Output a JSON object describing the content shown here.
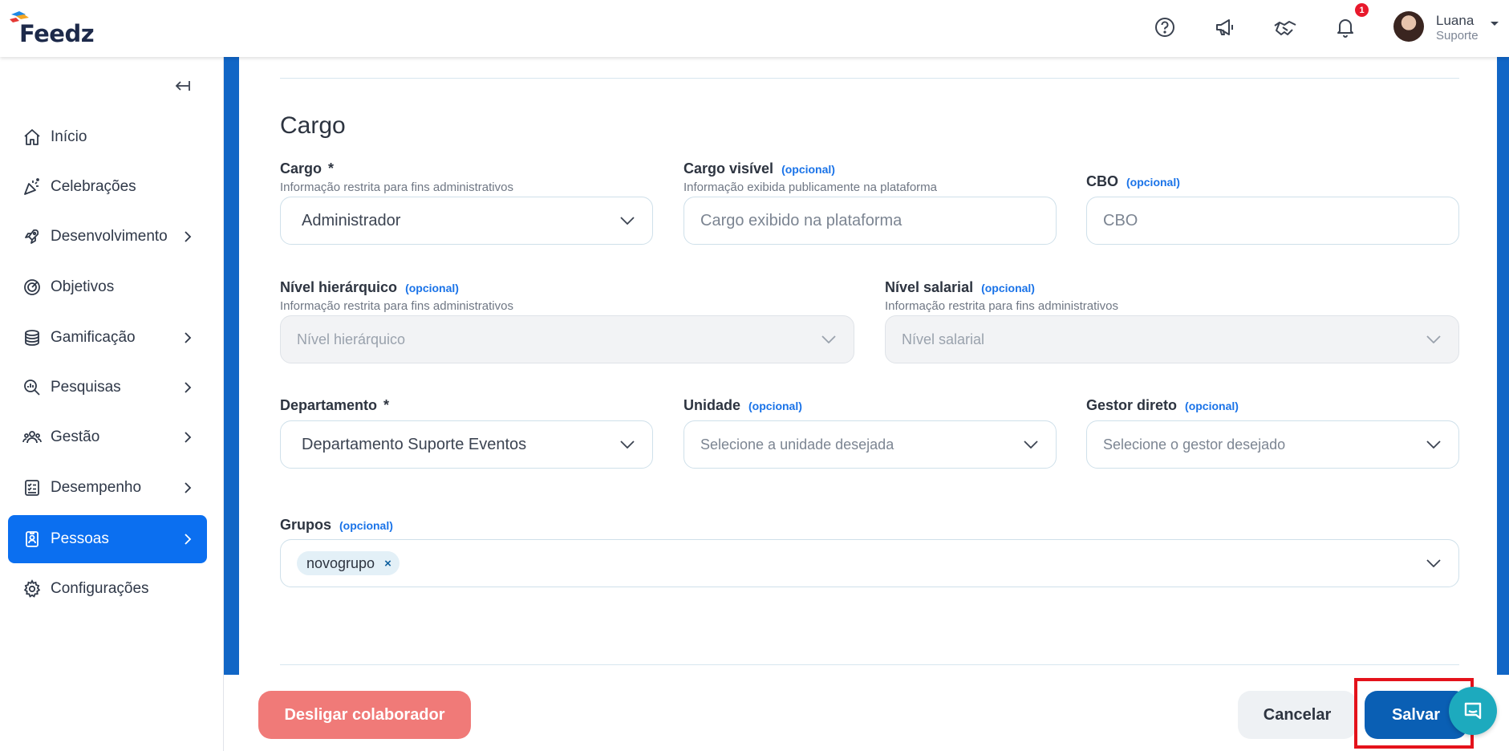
{
  "brand": {
    "name": "Feedz"
  },
  "topbar": {
    "icons": [
      "help-icon",
      "megaphone-icon",
      "handshake-icon",
      "bell-icon"
    ],
    "notification_count": "1",
    "user": {
      "name": "Luana",
      "role": "Suporte"
    }
  },
  "sidebar": {
    "items": [
      {
        "label": "Início",
        "icon": "home-icon",
        "has_children": false
      },
      {
        "label": "Celebrações",
        "icon": "party-icon",
        "has_children": false
      },
      {
        "label": "Desenvolvimento",
        "icon": "rocket-icon",
        "has_children": true
      },
      {
        "label": "Objetivos",
        "icon": "target-icon",
        "has_children": false
      },
      {
        "label": "Gamificação",
        "icon": "coins-icon",
        "has_children": true
      },
      {
        "label": "Pesquisas",
        "icon": "search-chart-icon",
        "has_children": true
      },
      {
        "label": "Gestão",
        "icon": "team-icon",
        "has_children": true
      },
      {
        "label": "Desempenho",
        "icon": "checklist-icon",
        "has_children": true
      },
      {
        "label": "Pessoas",
        "icon": "badge-icon",
        "has_children": true,
        "active": true
      },
      {
        "label": "Configurações",
        "icon": "gear-icon",
        "has_children": false
      }
    ]
  },
  "form": {
    "section_title": "Cargo",
    "optional_text": "(opcional)",
    "required_mark": "*",
    "cargo": {
      "label": "Cargo",
      "help": "Informação restrita para fins administrativos",
      "value": "Administrador"
    },
    "cargo_visivel": {
      "label": "Cargo visível",
      "help": "Informação exibida publicamente na plataforma",
      "placeholder": "Cargo exibido na plataforma"
    },
    "cbo": {
      "label": "CBO",
      "placeholder": "CBO"
    },
    "nivel_hierarquico": {
      "label": "Nível hierárquico",
      "help": "Informação restrita para fins administrativos",
      "placeholder": "Nível hierárquico"
    },
    "nivel_salarial": {
      "label": "Nível salarial",
      "help": "Informação restrita para fins administrativos",
      "placeholder": "Nível salarial"
    },
    "departamento": {
      "label": "Departamento",
      "value": "Departamento Suporte Eventos"
    },
    "unidade": {
      "label": "Unidade",
      "placeholder": "Selecione a unidade desejada"
    },
    "gestor": {
      "label": "Gestor direto",
      "placeholder": "Selecione o gestor desejado"
    },
    "grupos": {
      "label": "Grupos",
      "tags": [
        "novogrupo"
      ],
      "remove_glyph": "×"
    }
  },
  "footer": {
    "dismiss_label": "Desligar colaborador",
    "cancel_label": "Cancelar",
    "save_label": "Salvar"
  },
  "colors": {
    "primary": "#0b6ff0",
    "save": "#0a5fb4",
    "danger": "#f07a78",
    "optional": "#1a73e8",
    "highlight": "#e4121b",
    "chat": "#1daabe"
  }
}
